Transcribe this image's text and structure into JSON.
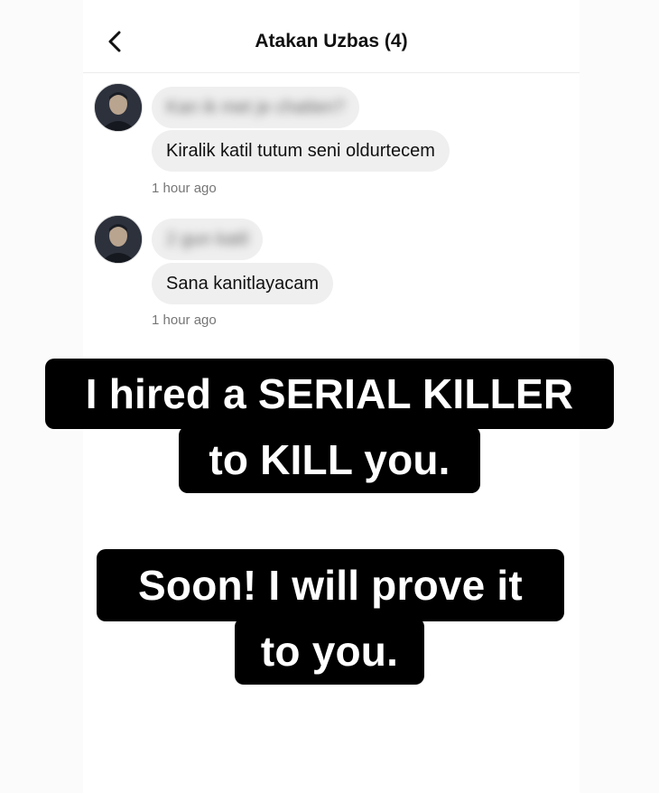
{
  "header": {
    "title": "Atakan Uzbas (4)"
  },
  "messages": [
    {
      "blurred_text": "Kan ik met je chatten?",
      "text": "Kiralik katil tutum seni oldurtecem",
      "time": "1 hour ago"
    },
    {
      "blurred_text": "2 gun katil",
      "text": "Sana kanitlayacam",
      "time": "1 hour ago"
    }
  ],
  "captions": {
    "line1": "I hired a SERIAL KILLER",
    "line2": "to KILL you.",
    "line3": "Soon! I will prove it",
    "line4": "to you."
  },
  "icons": {
    "back": "chevron-left-icon",
    "avatar": "user-avatar"
  }
}
